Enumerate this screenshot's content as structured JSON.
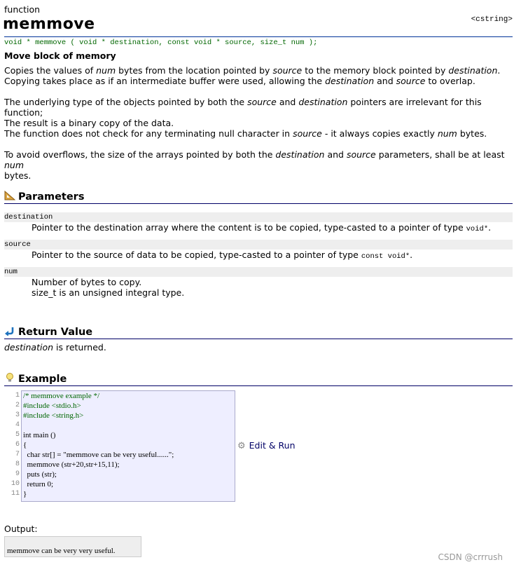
{
  "kind": "function",
  "title": "memmove",
  "header_file": "<cstring>",
  "prototype": "void * memmove ( void * destination, const void * source, size_t num );",
  "brief": "Move block of memory",
  "description": {
    "p1_a": "Copies the values of ",
    "p1_num": "num",
    "p1_b": " bytes from the location pointed by ",
    "p1_source": "source",
    "p1_c": " to the memory block pointed by ",
    "p1_dest": "destination",
    "p1_d": ".",
    "p1_e": "Copying takes place as if an intermediate buffer were used, allowing the ",
    "p1_dest2": "destination",
    "p1_f": " and ",
    "p1_source2": "source",
    "p1_g": " to overlap.",
    "p2_a": "The underlying type of the objects pointed by both the ",
    "p2_source": "source",
    "p2_b": " and ",
    "p2_dest": "destination",
    "p2_c": " pointers are irrelevant for this function;",
    "p2_d": "The result is a binary copy of the data.",
    "p3_a": "The function does not check for any terminating null character in ",
    "p3_source": "source",
    "p3_b": " - it always copies exactly ",
    "p3_num": "num",
    "p3_c": " bytes.",
    "p4_a": "To avoid overflows, the size of the arrays pointed by both the ",
    "p4_dest": "destination",
    "p4_b": " and ",
    "p4_source": "source",
    "p4_c": " parameters, shall be at least ",
    "p4_num": "num",
    "p4_d": "bytes."
  },
  "parameters": {
    "heading": "Parameters",
    "icon": "ruler-triangle-icon",
    "items": [
      {
        "name": "destination",
        "desc": "Pointer to the destination array where the content is to be copied, type-casted to a pointer of type ",
        "type": "void*",
        "end": "."
      },
      {
        "name": "source",
        "desc": "Pointer to the source of data to be copied, type-casted to a pointer of type ",
        "type": "const void*",
        "end": "."
      },
      {
        "name": "num",
        "desc": "Number of bytes to copy.",
        "desc2": "size_t is an unsigned integral type."
      }
    ]
  },
  "return_value": {
    "heading": "Return Value",
    "icon": "return-arrow-icon",
    "text_em": "destination",
    "text": " is returned."
  },
  "example": {
    "heading": "Example",
    "icon": "lightbulb-icon",
    "line_numbers": [
      "1",
      "2",
      "3",
      "4",
      "5",
      "6",
      "7",
      "8",
      "9",
      "10",
      "11"
    ],
    "lines": [
      "/* memmove example */",
      "#include <stdio.h>",
      "#include <string.h>",
      "",
      "int main ()",
      "{",
      "  char str[] = \"memmove can be very useful......\";",
      "  memmove (str+20,str+15,11);",
      "  puts (str);",
      "  return 0;",
      "}"
    ],
    "edit_run": "Edit & Run",
    "output_label": "Output:",
    "output": "memmove can be very very useful."
  },
  "watermark": "CSDN @crrrush",
  "colors": {
    "prototype": "#006600",
    "rule": "#000066",
    "code_bg": "#eeeeff"
  }
}
